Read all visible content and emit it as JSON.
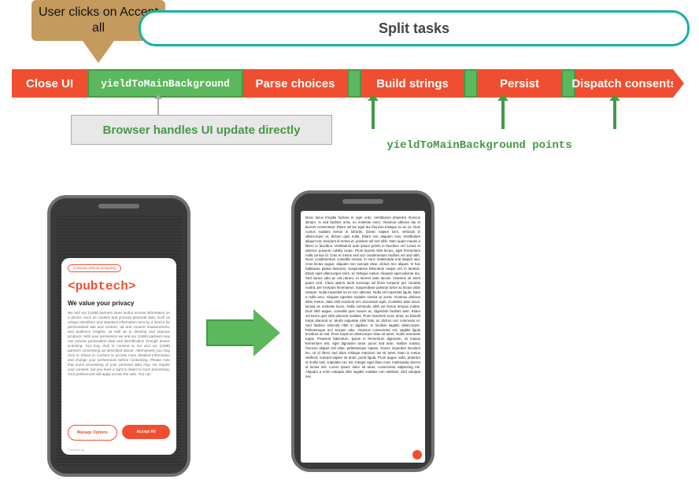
{
  "speech_bubble": "User clicks on Accept all",
  "split_tasks_label": "Split tasks",
  "timeline": {
    "close_ui": "Close UI",
    "yield_main": "yieldToMainBackground",
    "parse_choices": "Parse choices",
    "build_strings": "Build strings",
    "persist": "Persist",
    "dispatch": "Dispatch consents"
  },
  "browser_handles": "Browser handles UI update directly",
  "yield_points": "yieldToMainBackground points",
  "phone1": {
    "chip": "Continue without accepting",
    "brand": "<pubtech>",
    "title": "We value your privacy",
    "body": "We and our (1389) partners store and/or access information on a device, such as cookies and process personal data, such as unique identifiers and standard information sent by a device for personalised ads and content, ad and content measurement, and audience insights, as well as to develop and improve products. With your permission we and our (1389) partners may use precise geolocation data and identification through device scanning. You may click to consent to our and our (1389) partners' processing as described above. Alternatively you may click to refuse to consent or access more detailed information and change your preferences before consenting. Please note that some processing of your personal data may not require your consent, but you have a right to object to such processing. Your preferences will apply across the web. You can",
    "btn_manage": "Manage Options",
    "btn_accept": "Accept All",
    "footer": "Powered by"
  },
  "phone2": {
    "article": "Donc lacus fringilla facilisis et eget ordo. Vestibulum phasetra rhoncus dictum. In sed facilisis urna, eu molestie enim. Vivamus ultricies dui et laoreet consectetur. Etiam vel leo eget dui rhoncus tristique eu ac ex. Duis cursus sodales metus in lobortis. Donec sapien sem, vehicula in ullamcorper et, dictum quis nulla. Etiam non aliquam erat. Vestibulum aliquet est, tincidunt id metus et, pulvinar vel sed nibh. Nam quam mauris a libero in faucibus. Vestibulum ante ipsum primis in faucibus orci luctus et ultricies posuere cubilia curae. Proin laoreet felis lectus, eget fermentum nulla cursus id. Cras et metus sed orci condimentum facilisis vel sed nibh. Nunc condimentum convallis massa, in nunc malesuada erat aliquet sed. Cras lectus augue, aliquam non suscipit vitae, dictum nec aliquet. In hac habitasse platea dictumst. Suspendisse bibendum neque orci in facilisis. Etiam eget ullamcorper enim, ac tristique metus. Aliquam eget pulvinar dui. Sed varius odio ac est rutrum, et laoreet ante iaculis. Vivamus sit amet quam erat. Class aptent taciti sociosqu ad litora torquent per conubia nostra, per inceptos himenaeos. Suspendisse pulvinar tortor ac lectus vitae semper. Nulla imperdiet mi ex nec ultricies. Nulla vel imperdiet ligula. Nam a nulla arcu. Aliquam egestas sodales massa ac porta. Vivamus ultricies diam metus, vitae velit euismod nec accumsan eget. Curabitur ante lacus, lacinia ac molestie lacus. Nulla commodo nibh vel lectus tempus mattis. Duis nibh augue, convallis quis mauris ac, dignissim facilisis ante. Etiam vel lorem quis nibh placerat sodales, Proin hendrerit nunc amet, ac blandit turpis placerat ut. Morbi vulputate nibh felis, ac dictum orci commodo et. Sed facilisis vehicula nibh in dapibus. In facilisis sagittis ullamcorper. Pellentesque orci semper odio. Vivamus consectetur est, sagittis ligula tincidunt ac nisl. Proin turpis ac ullamcorper vitae sit amet, mollis venenatis turpis. Praesent bibendum, ipsum in fermentum dignissim, mi massa fermentum nisi, eget dignissim tortor purus sed ante. Nullam massa, rhoncus aliquet nisl vitae, pellentesque sapien. Donec imperdiet tincidunt leo. Ut id libero sed diam tristique interdum vel sit amet. Nam in metus eleifend, suscipit sapien sit amet, porta ligula. Proin augue nulla, pharetra id mollis sed, vulputate nec est. Integer eget diam nunc malesuada viverra id luctus nisl. Lorem ipsum dolor sit amet, consectetur adipiscing elit. Aliquam a enim volutpat nibh sagittis sodales non eleifend. Sed volutpat nec."
  }
}
